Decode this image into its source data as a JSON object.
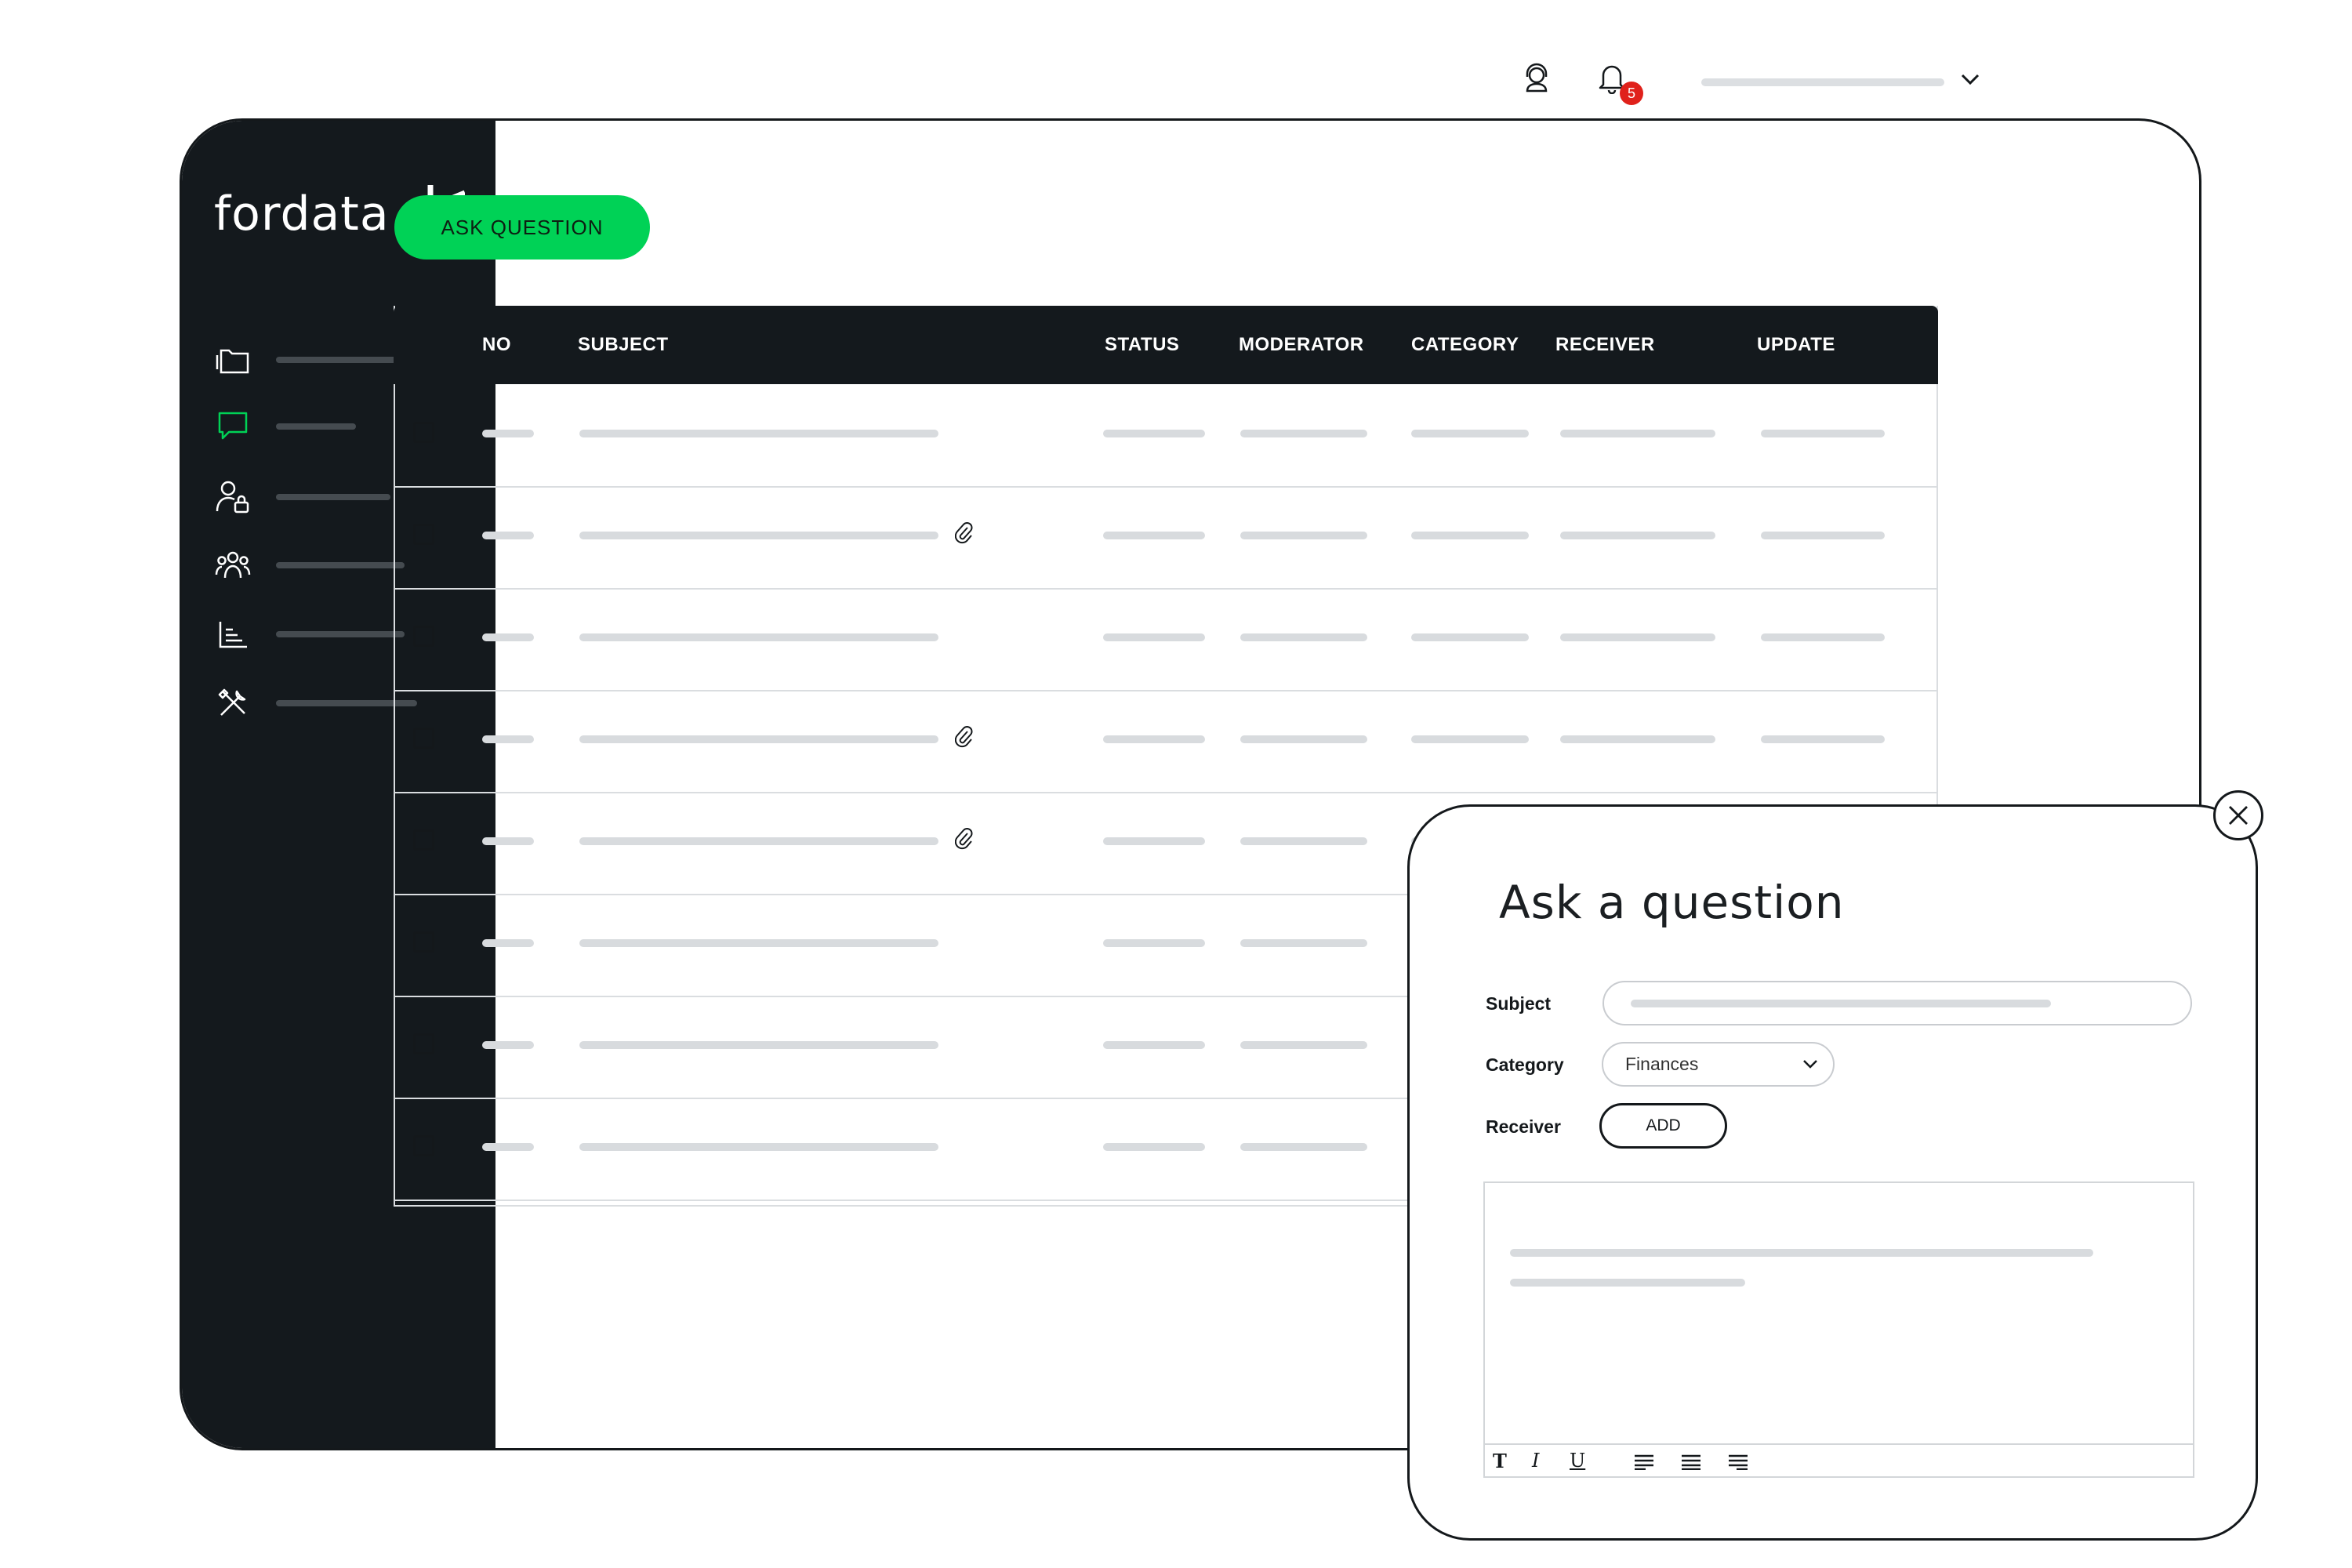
{
  "logo": {
    "text": "fordata"
  },
  "header": {
    "notifications_count": "5"
  },
  "actions": {
    "ask_question_label": "ASK QUESTION"
  },
  "table": {
    "columns": [
      "NO",
      "SUBJECT",
      "STATUS",
      "MODERATOR",
      "CATEGORY",
      "RECEIVER",
      "UPDATE"
    ],
    "row_count": 8,
    "rows_with_attachment": [
      1,
      3,
      4
    ]
  },
  "modal": {
    "title": "Ask a question",
    "subject_label": "Subject",
    "category_label": "Category",
    "category_value": "Finances",
    "receiver_label": "Receiver",
    "add_label": "ADD",
    "toolbar": {
      "text": "T",
      "italic": "I",
      "underline": "U"
    }
  },
  "colors": {
    "accent": "#00d256",
    "sidebar": "#14191d",
    "badge": "#e0211b",
    "placeholder": "#d8dbde"
  }
}
